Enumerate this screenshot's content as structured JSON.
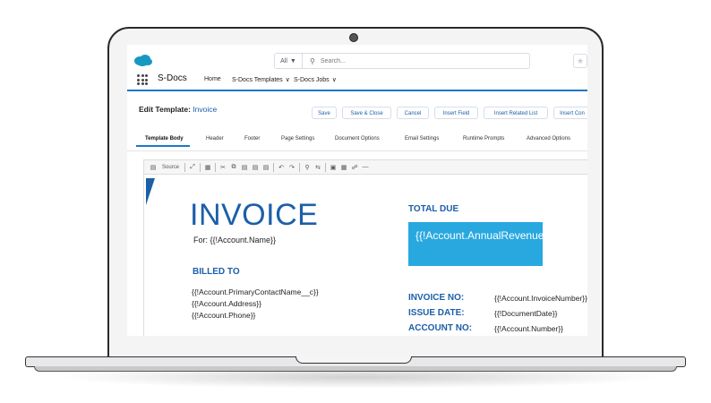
{
  "header": {
    "search_scope": "All",
    "search_placeholder": "Search..."
  },
  "appbar": {
    "app_name": "S-Docs",
    "nav": [
      "Home",
      "S-Docs Templates",
      "S-Docs Jobs"
    ]
  },
  "edit": {
    "title_label": "Edit Template:",
    "title_value": "Invoice",
    "buttons": [
      "Save",
      "Save & Close",
      "Cancel",
      "Insert Field",
      "Insert Related List",
      "Insert Con"
    ]
  },
  "tabs": [
    "Template Body",
    "Header",
    "Footer",
    "Page Settings",
    "Document Options",
    "Email Settings",
    "Runtime Prompts",
    "Advanced Options"
  ],
  "toolbar": {
    "source_label": "Source"
  },
  "document": {
    "title": "INVOICE",
    "for_line": "For: {{!Account.Name}}",
    "billed_to_label": "BILLED TO",
    "billed_to_lines": [
      "{{!Account.PrimaryContactName__c}}",
      "{{!Account.Address}}",
      "{{!Account.Phone}}"
    ],
    "total_due_label": "TOTAL DUE",
    "total_due_value": "{{!Account.AnnualRevenue}}",
    "info": [
      {
        "label": "INVOICE NO:",
        "value": "{{!Account.InvoiceNumber}}"
      },
      {
        "label": "ISSUE DATE:",
        "value": "{{!DocumentDate}}"
      },
      {
        "label": "ACCOUNT NO:",
        "value": "{{!Account.Number}}"
      }
    ]
  },
  "colors": {
    "accent": "#1b5fa8",
    "total_box": "#29a8e0",
    "nav_underline": "#1b78c9"
  }
}
